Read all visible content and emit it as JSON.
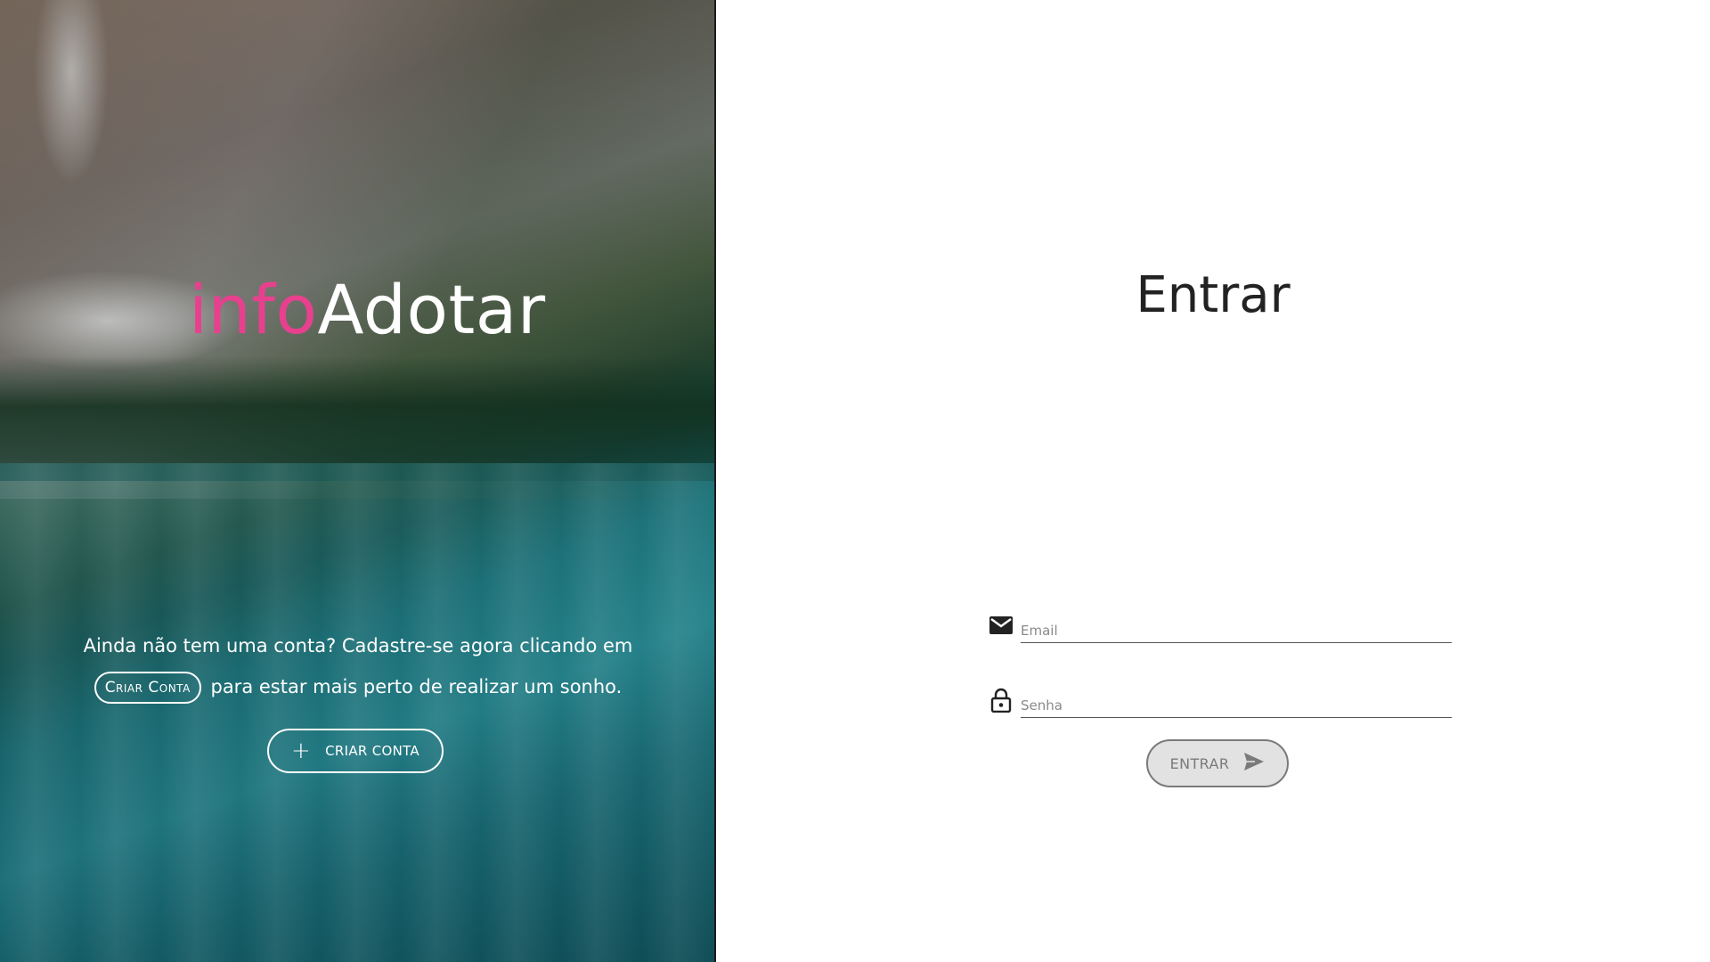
{
  "brand": {
    "part1": "info",
    "part2": "Adotar"
  },
  "signup": {
    "text_before": "Ainda não tem uma conta? Cadastre-se agora clicando em",
    "inline_button": "Criar Conta",
    "text_after": "para estar mais perto de realizar um sonho.",
    "button_label": "CRIAR CONTA",
    "button_icon": "plus-icon"
  },
  "login": {
    "title": "Entrar",
    "email_placeholder": "Email",
    "email_icon": "mail-icon",
    "password_placeholder": "Senha",
    "password_icon": "lock-icon",
    "button_label": "ENTRAR",
    "button_icon": "send-icon"
  },
  "colors": {
    "brand_accent": "#e8408e",
    "text_dark": "#222222",
    "button_disabled_bg": "#e2e2e2",
    "button_disabled_text": "#7a7a7a"
  }
}
